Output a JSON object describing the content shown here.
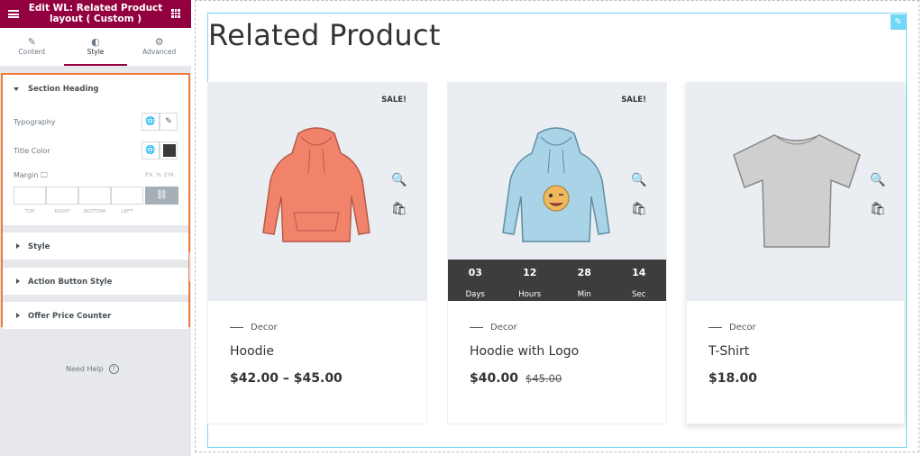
{
  "panel": {
    "title": "Edit WL: Related Product layout ( Custom )",
    "tabs": [
      {
        "label": "Content",
        "icon": "pencil-icon"
      },
      {
        "label": "Style",
        "icon": "half-circle-icon"
      },
      {
        "label": "Advanced",
        "icon": "gear-icon"
      }
    ],
    "section_heading": "Section Heading",
    "typography_label": "Typography",
    "title_color_label": "Title Color",
    "title_color_value": "#3a3a3a",
    "margin_label": "Margin",
    "units": "PX % EM",
    "dim_labels": [
      "TOP",
      "RIGHT",
      "BOTTOM",
      "LEFT"
    ],
    "sections": [
      "Style",
      "Action Button Style",
      "Offer Price Counter"
    ],
    "help": "Need Help",
    "accent": "#93003f",
    "highlight": "#f07a3a"
  },
  "page": {
    "heading": "Related Product",
    "products": [
      {
        "name": "Hoodie",
        "category": "Decor",
        "price": "$42.00 – $45.00",
        "old_price": "",
        "sale": "SALE!",
        "countdown": null,
        "color": "#f2836b"
      },
      {
        "name": "Hoodie with Logo",
        "category": "Decor",
        "price": "$40.00",
        "old_price": "$45.00",
        "sale": "SALE!",
        "countdown": [
          {
            "v": "03",
            "u": "Days"
          },
          {
            "v": "12",
            "u": "Hours"
          },
          {
            "v": "28",
            "u": "Min"
          },
          {
            "v": "14",
            "u": "Sec"
          }
        ],
        "color": "#a9d3e6"
      },
      {
        "name": "T-Shirt",
        "category": "Decor",
        "price": "$18.00",
        "old_price": "",
        "sale": "",
        "countdown": null,
        "color": "#c9c9c9"
      }
    ]
  }
}
